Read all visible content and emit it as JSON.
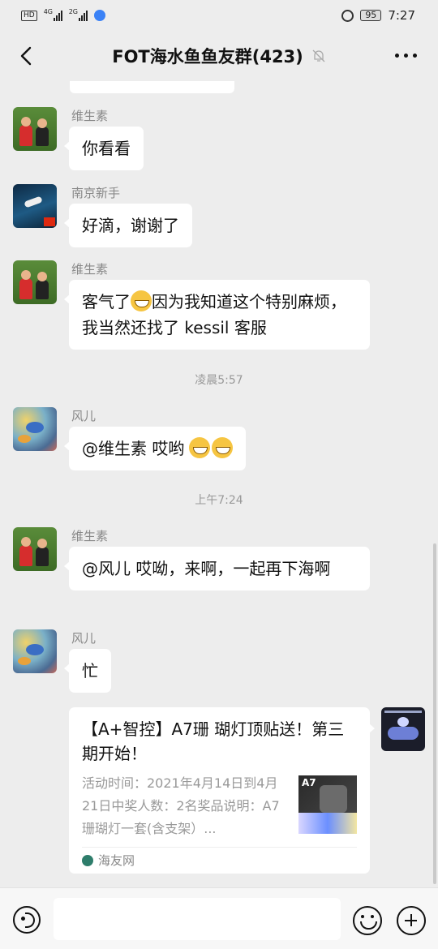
{
  "status_bar": {
    "network_tag": "HD",
    "net1": "4G",
    "net2": "2G",
    "battery": "95",
    "time": "7:27"
  },
  "header": {
    "title": "FOT海水鱼鱼友群(423)"
  },
  "messages": [
    {
      "sender": "维生素",
      "text": "你看看"
    },
    {
      "sender": "南京新手",
      "text": "好滴，谢谢了"
    },
    {
      "sender": "维生素",
      "text_before_emoji": "客气了",
      "text_after_emoji": "因为我知道这个特别麻烦，我当然还找了 kessil 客服",
      "emoji": "grinning-face"
    },
    {
      "sender": "风儿",
      "text": "@维生素  哎哟",
      "emoji": [
        "laughing-tears-face",
        "covering-mouth-face"
      ]
    },
    {
      "sender": "维生素",
      "text": "@风儿  哎呦，来啊，一起再下海啊"
    },
    {
      "sender": "风儿",
      "text": "忙"
    }
  ],
  "timestamps": [
    "凌晨5:57",
    "上午7:24"
  ],
  "link_card": {
    "title": "【A+智控】A7珊 瑚灯顶贴送！第三期开始！",
    "description": "活动时间：2021年4月14日到4月21日中奖人数：2名奖品说明：A7珊瑚灯一套(含支架）...",
    "thumb_label": "A7",
    "source": "海友网"
  },
  "input_bar": {
    "placeholder": ""
  }
}
